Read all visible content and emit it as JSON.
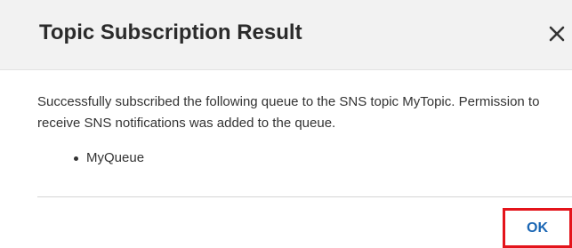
{
  "dialog": {
    "title": "Topic Subscription Result",
    "close_icon": "close-icon",
    "message": "Successfully subscribed the following queue to the SNS topic MyTopic. Permission to receive SNS notifications was added to the queue.",
    "queues": [
      "MyQueue"
    ],
    "ok_label": "OK"
  },
  "colors": {
    "header_bg": "#f2f2f2",
    "title_text": "#2b2b2b",
    "body_text": "#333333",
    "ok_text": "#1a66b4",
    "highlight_border": "#e4141b"
  }
}
